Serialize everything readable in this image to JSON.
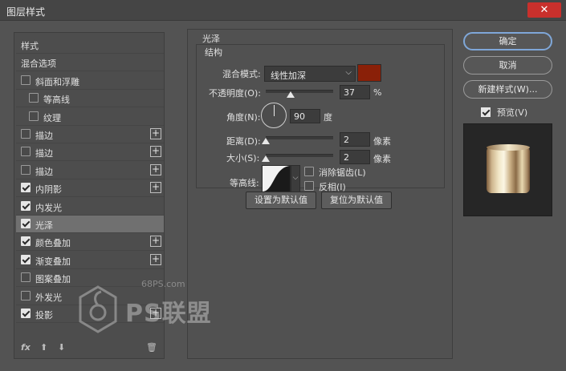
{
  "window": {
    "title": "图层样式",
    "close_glyph": "✕"
  },
  "style_list": {
    "items": [
      {
        "label": "样式",
        "checkbox": null,
        "plus": false,
        "indent": 0,
        "selected": false
      },
      {
        "label": "混合选项",
        "checkbox": null,
        "plus": false,
        "indent": 0,
        "selected": false
      },
      {
        "label": "斜面和浮雕",
        "checkbox": false,
        "plus": false,
        "indent": 0,
        "selected": false
      },
      {
        "label": "等高线",
        "checkbox": false,
        "plus": false,
        "indent": 1,
        "selected": false
      },
      {
        "label": "纹理",
        "checkbox": false,
        "plus": false,
        "indent": 1,
        "selected": false
      },
      {
        "label": "描边",
        "checkbox": false,
        "plus": true,
        "indent": 0,
        "selected": false
      },
      {
        "label": "描边",
        "checkbox": false,
        "plus": true,
        "indent": 0,
        "selected": false
      },
      {
        "label": "描边",
        "checkbox": false,
        "plus": true,
        "indent": 0,
        "selected": false
      },
      {
        "label": "内阴影",
        "checkbox": true,
        "plus": true,
        "indent": 0,
        "selected": false
      },
      {
        "label": "内发光",
        "checkbox": true,
        "plus": false,
        "indent": 0,
        "selected": false
      },
      {
        "label": "光泽",
        "checkbox": true,
        "plus": false,
        "indent": 0,
        "selected": true
      },
      {
        "label": "颜色叠加",
        "checkbox": true,
        "plus": true,
        "indent": 0,
        "selected": false
      },
      {
        "label": "渐变叠加",
        "checkbox": true,
        "plus": true,
        "indent": 0,
        "selected": false
      },
      {
        "label": "图案叠加",
        "checkbox": false,
        "plus": false,
        "indent": 0,
        "selected": false
      },
      {
        "label": "外发光",
        "checkbox": false,
        "plus": false,
        "indent": 0,
        "selected": false
      },
      {
        "label": "投影",
        "checkbox": true,
        "plus": true,
        "indent": 0,
        "selected": false
      }
    ],
    "footer": {
      "fx": "fx",
      "up": "⬆",
      "down": "⬇",
      "trash": "🗑"
    }
  },
  "satin": {
    "group_title": "光泽",
    "structure_title": "结构",
    "blend_mode_label": "混合模式:",
    "blend_mode_value": "线性加深",
    "color": "#8a2008",
    "opacity_label": "不透明度(O):",
    "opacity_value": "37",
    "opacity_unit": "%",
    "opacity_level": 0.37,
    "angle_label": "角度(N):",
    "angle_value": "90",
    "angle_unit": "度",
    "distance_label": "距离(D):",
    "distance_value": "2",
    "distance_unit": "像素",
    "size_label": "大小(S):",
    "size_value": "2",
    "size_unit": "像素",
    "contour_label": "等高线:",
    "antialias_label": "消除锯齿(L)",
    "invert_label": "反相(I)",
    "set_default": "设置为默认值",
    "reset_default": "复位为默认值"
  },
  "actions": {
    "ok": "确定",
    "cancel": "取消",
    "new_style": "新建样式(W)...",
    "preview_label": "预览(V)",
    "preview_checked": true
  },
  "watermark": {
    "site": "68PS.com",
    "brand": "PS联盟"
  }
}
